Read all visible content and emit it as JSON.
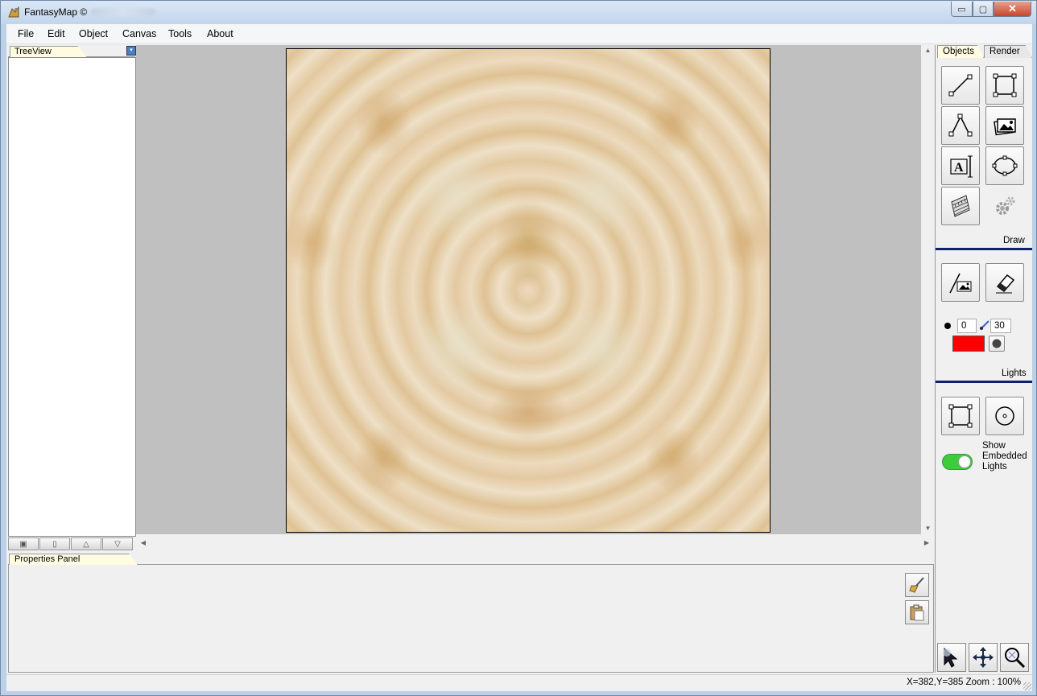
{
  "window": {
    "title": "FantasyMap ©",
    "min_glyph": "▭",
    "max_glyph": "▢",
    "close_glyph": "✕"
  },
  "menu": [
    "File",
    "Edit",
    "Object",
    "Canvas",
    "Tools",
    "About"
  ],
  "treeview": {
    "tab_label": "TreeView",
    "pin_glyph": "▾",
    "tool_glyphs": [
      "▣",
      "▯",
      "△",
      "▽"
    ]
  },
  "canvas": {
    "scroll_up": "▲",
    "scroll_down": "▼",
    "scroll_left": "◀",
    "scroll_right": "▶"
  },
  "properties": {
    "tab_label": "Properties Panel"
  },
  "right_panel": {
    "tabs": [
      "Objects",
      "Render"
    ],
    "draw_label": "Draw",
    "lights_label": "Lights",
    "brush_size": "0",
    "brush_opacity": "30",
    "light_color": "#ff0000",
    "toggle_color": "#3ccc3c",
    "toggle_label": "Show Embedded Lights",
    "toggle_on": true
  },
  "status": {
    "text": "X=382,Y=385  Zoom : 100%"
  }
}
